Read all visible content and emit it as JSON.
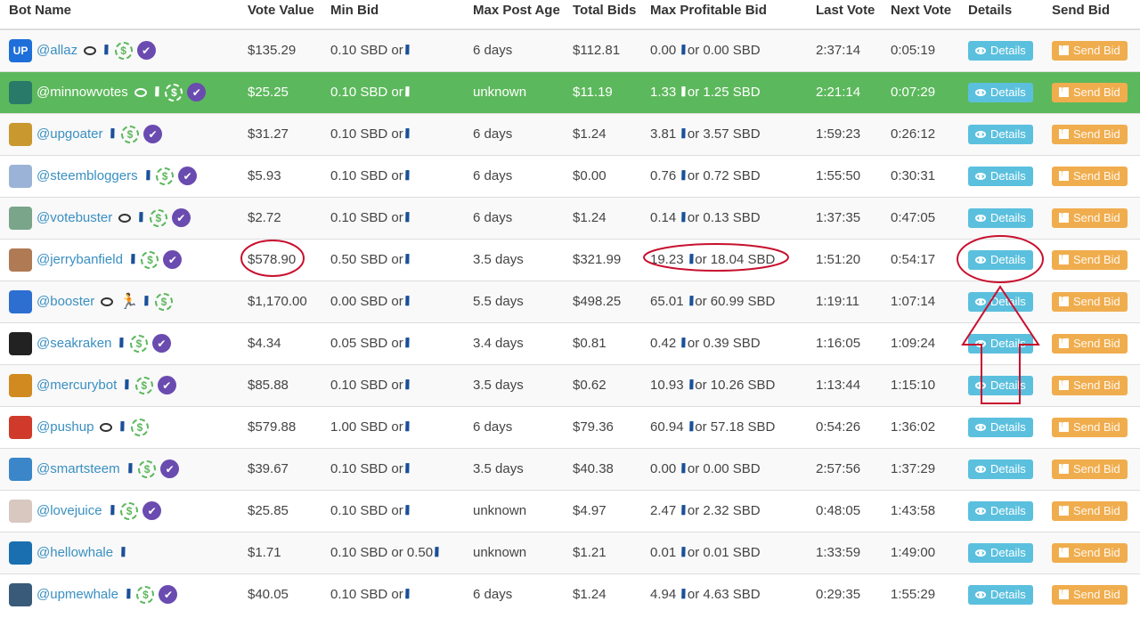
{
  "headers": {
    "bot_name": "Bot Name",
    "vote_value": "Vote Value",
    "min_bid": "Min Bid",
    "max_post_age": "Max Post Age",
    "total_bids": "Total Bids",
    "max_profitable_bid": "Max Profitable Bid",
    "last_vote": "Last Vote",
    "next_vote": "Next Vote",
    "details": "Details",
    "send_bid": "Send Bid"
  },
  "buttons": {
    "details_label": "Details",
    "send_bid_label": "Send Bid"
  },
  "or_word": "or",
  "steem_glyph": "\\\\\\",
  "dollar_glyph": "$",
  "check_glyph": "✔",
  "runner_glyph": "🏃",
  "rows": [
    {
      "name": "@allaz",
      "avatar": "UP",
      "avatar_color": "#1e6fd9",
      "comment": true,
      "runner": false,
      "steem": true,
      "dollar": true,
      "check": true,
      "vote_value": "$135.29",
      "min_bid": "0.10 SBD or",
      "min_bid_steem": true,
      "max_post_age": "6 days",
      "total_bids": "$112.81",
      "mpb_a": "0.00",
      "mpb_b": "0.00 SBD",
      "last_vote": "2:37:14",
      "next_vote": "0:05:19",
      "highlight": false
    },
    {
      "name": "@minnowvotes",
      "avatar": "",
      "avatar_color": "#2a7a6a",
      "comment": true,
      "runner": false,
      "steem": true,
      "dollar": true,
      "check": true,
      "vote_value": "$25.25",
      "min_bid": "0.10 SBD or",
      "min_bid_steem": true,
      "max_post_age": "unknown",
      "total_bids": "$11.19",
      "mpb_a": "1.33",
      "mpb_b": "1.25 SBD",
      "last_vote": "2:21:14",
      "next_vote": "0:07:29",
      "highlight": true
    },
    {
      "name": "@upgoater",
      "avatar": "",
      "avatar_color": "#c9982f",
      "comment": false,
      "runner": false,
      "steem": true,
      "dollar": true,
      "check": true,
      "vote_value": "$31.27",
      "min_bid": "0.10 SBD or",
      "min_bid_steem": true,
      "max_post_age": "6 days",
      "total_bids": "$1.24",
      "mpb_a": "3.81",
      "mpb_b": "3.57 SBD",
      "last_vote": "1:59:23",
      "next_vote": "0:26:12",
      "highlight": false
    },
    {
      "name": "@steembloggers",
      "avatar": "",
      "avatar_color": "#9bb3d6",
      "comment": false,
      "runner": false,
      "steem": true,
      "dollar": true,
      "check": true,
      "vote_value": "$5.93",
      "min_bid": "0.10 SBD or",
      "min_bid_steem": true,
      "max_post_age": "6 days",
      "total_bids": "$0.00",
      "mpb_a": "0.76",
      "mpb_b": "0.72 SBD",
      "last_vote": "1:55:50",
      "next_vote": "0:30:31",
      "highlight": false
    },
    {
      "name": "@votebuster",
      "avatar": "",
      "avatar_color": "#7aa58a",
      "comment": true,
      "runner": false,
      "steem": true,
      "dollar": true,
      "check": true,
      "vote_value": "$2.72",
      "min_bid": "0.10 SBD or",
      "min_bid_steem": true,
      "max_post_age": "6 days",
      "total_bids": "$1.24",
      "mpb_a": "0.14",
      "mpb_b": "0.13 SBD",
      "last_vote": "1:37:35",
      "next_vote": "0:47:05",
      "highlight": false
    },
    {
      "name": "@jerrybanfield",
      "avatar": "",
      "avatar_color": "#b07a55",
      "comment": false,
      "runner": false,
      "steem": true,
      "dollar": true,
      "check": true,
      "vote_value": "$578.90",
      "min_bid": "0.50 SBD or",
      "min_bid_steem": true,
      "max_post_age": "3.5 days",
      "total_bids": "$321.99",
      "mpb_a": "19.23",
      "mpb_b": "18.04 SBD",
      "last_vote": "1:51:20",
      "next_vote": "0:54:17",
      "highlight": false
    },
    {
      "name": "@booster",
      "avatar": "",
      "avatar_color": "#2d6fd0",
      "comment": true,
      "runner": true,
      "steem": true,
      "dollar": true,
      "check": false,
      "vote_value": "$1,170.00",
      "min_bid": "0.00 SBD or",
      "min_bid_steem": true,
      "max_post_age": "5.5 days",
      "total_bids": "$498.25",
      "mpb_a": "65.01",
      "mpb_b": "60.99 SBD",
      "last_vote": "1:19:11",
      "next_vote": "1:07:14",
      "highlight": false
    },
    {
      "name": "@seakraken",
      "avatar": "",
      "avatar_color": "#222222",
      "comment": false,
      "runner": false,
      "steem": true,
      "dollar": true,
      "check": true,
      "vote_value": "$4.34",
      "min_bid": "0.05 SBD or",
      "min_bid_steem": true,
      "max_post_age": "3.4 days",
      "total_bids": "$0.81",
      "mpb_a": "0.42",
      "mpb_b": "0.39 SBD",
      "last_vote": "1:16:05",
      "next_vote": "1:09:24",
      "highlight": false
    },
    {
      "name": "@mercurybot",
      "avatar": "",
      "avatar_color": "#d08a20",
      "comment": false,
      "runner": false,
      "steem": true,
      "dollar": true,
      "check": true,
      "vote_value": "$85.88",
      "min_bid": "0.10 SBD or",
      "min_bid_steem": true,
      "max_post_age": "3.5 days",
      "total_bids": "$0.62",
      "mpb_a": "10.93",
      "mpb_b": "10.26 SBD",
      "last_vote": "1:13:44",
      "next_vote": "1:15:10",
      "highlight": false
    },
    {
      "name": "@pushup",
      "avatar": "",
      "avatar_color": "#d03a2a",
      "comment": true,
      "runner": false,
      "steem": true,
      "dollar": true,
      "check": false,
      "vote_value": "$579.88",
      "min_bid": "1.00 SBD or",
      "min_bid_steem": true,
      "max_post_age": "6 days",
      "total_bids": "$79.36",
      "mpb_a": "60.94",
      "mpb_b": "57.18 SBD",
      "last_vote": "0:54:26",
      "next_vote": "1:36:02",
      "highlight": false
    },
    {
      "name": "@smartsteem",
      "avatar": "",
      "avatar_color": "#3a86c8",
      "comment": false,
      "runner": false,
      "steem": true,
      "dollar": true,
      "check": true,
      "vote_value": "$39.67",
      "min_bid": "0.10 SBD or",
      "min_bid_steem": true,
      "max_post_age": "3.5 days",
      "total_bids": "$40.38",
      "mpb_a": "0.00",
      "mpb_b": "0.00 SBD",
      "last_vote": "2:57:56",
      "next_vote": "1:37:29",
      "highlight": false
    },
    {
      "name": "@lovejuice",
      "avatar": "",
      "avatar_color": "#d8c8c0",
      "comment": false,
      "runner": false,
      "steem": true,
      "dollar": true,
      "check": true,
      "vote_value": "$25.85",
      "min_bid": "0.10 SBD or",
      "min_bid_steem": true,
      "max_post_age": "unknown",
      "total_bids": "$4.97",
      "mpb_a": "2.47",
      "mpb_b": "2.32 SBD",
      "last_vote": "0:48:05",
      "next_vote": "1:43:58",
      "highlight": false
    },
    {
      "name": "@hellowhale",
      "avatar": "",
      "avatar_color": "#1a6fb0",
      "comment": false,
      "runner": false,
      "steem": true,
      "dollar": false,
      "check": false,
      "vote_value": "$1.71",
      "min_bid": "0.10 SBD or 0.50",
      "min_bid_steem": true,
      "max_post_age": "unknown",
      "total_bids": "$1.21",
      "mpb_a": "0.01",
      "mpb_b": "0.01 SBD",
      "last_vote": "1:33:59",
      "next_vote": "1:49:00",
      "highlight": false
    },
    {
      "name": "@upmewhale",
      "avatar": "",
      "avatar_color": "#3a5a7a",
      "comment": false,
      "runner": false,
      "steem": true,
      "dollar": true,
      "check": true,
      "vote_value": "$40.05",
      "min_bid": "0.10 SBD or",
      "min_bid_steem": true,
      "max_post_age": "6 days",
      "total_bids": "$1.24",
      "mpb_a": "4.94",
      "mpb_b": "4.63 SBD",
      "last_vote": "0:29:35",
      "next_vote": "1:55:29",
      "highlight": false
    }
  ]
}
